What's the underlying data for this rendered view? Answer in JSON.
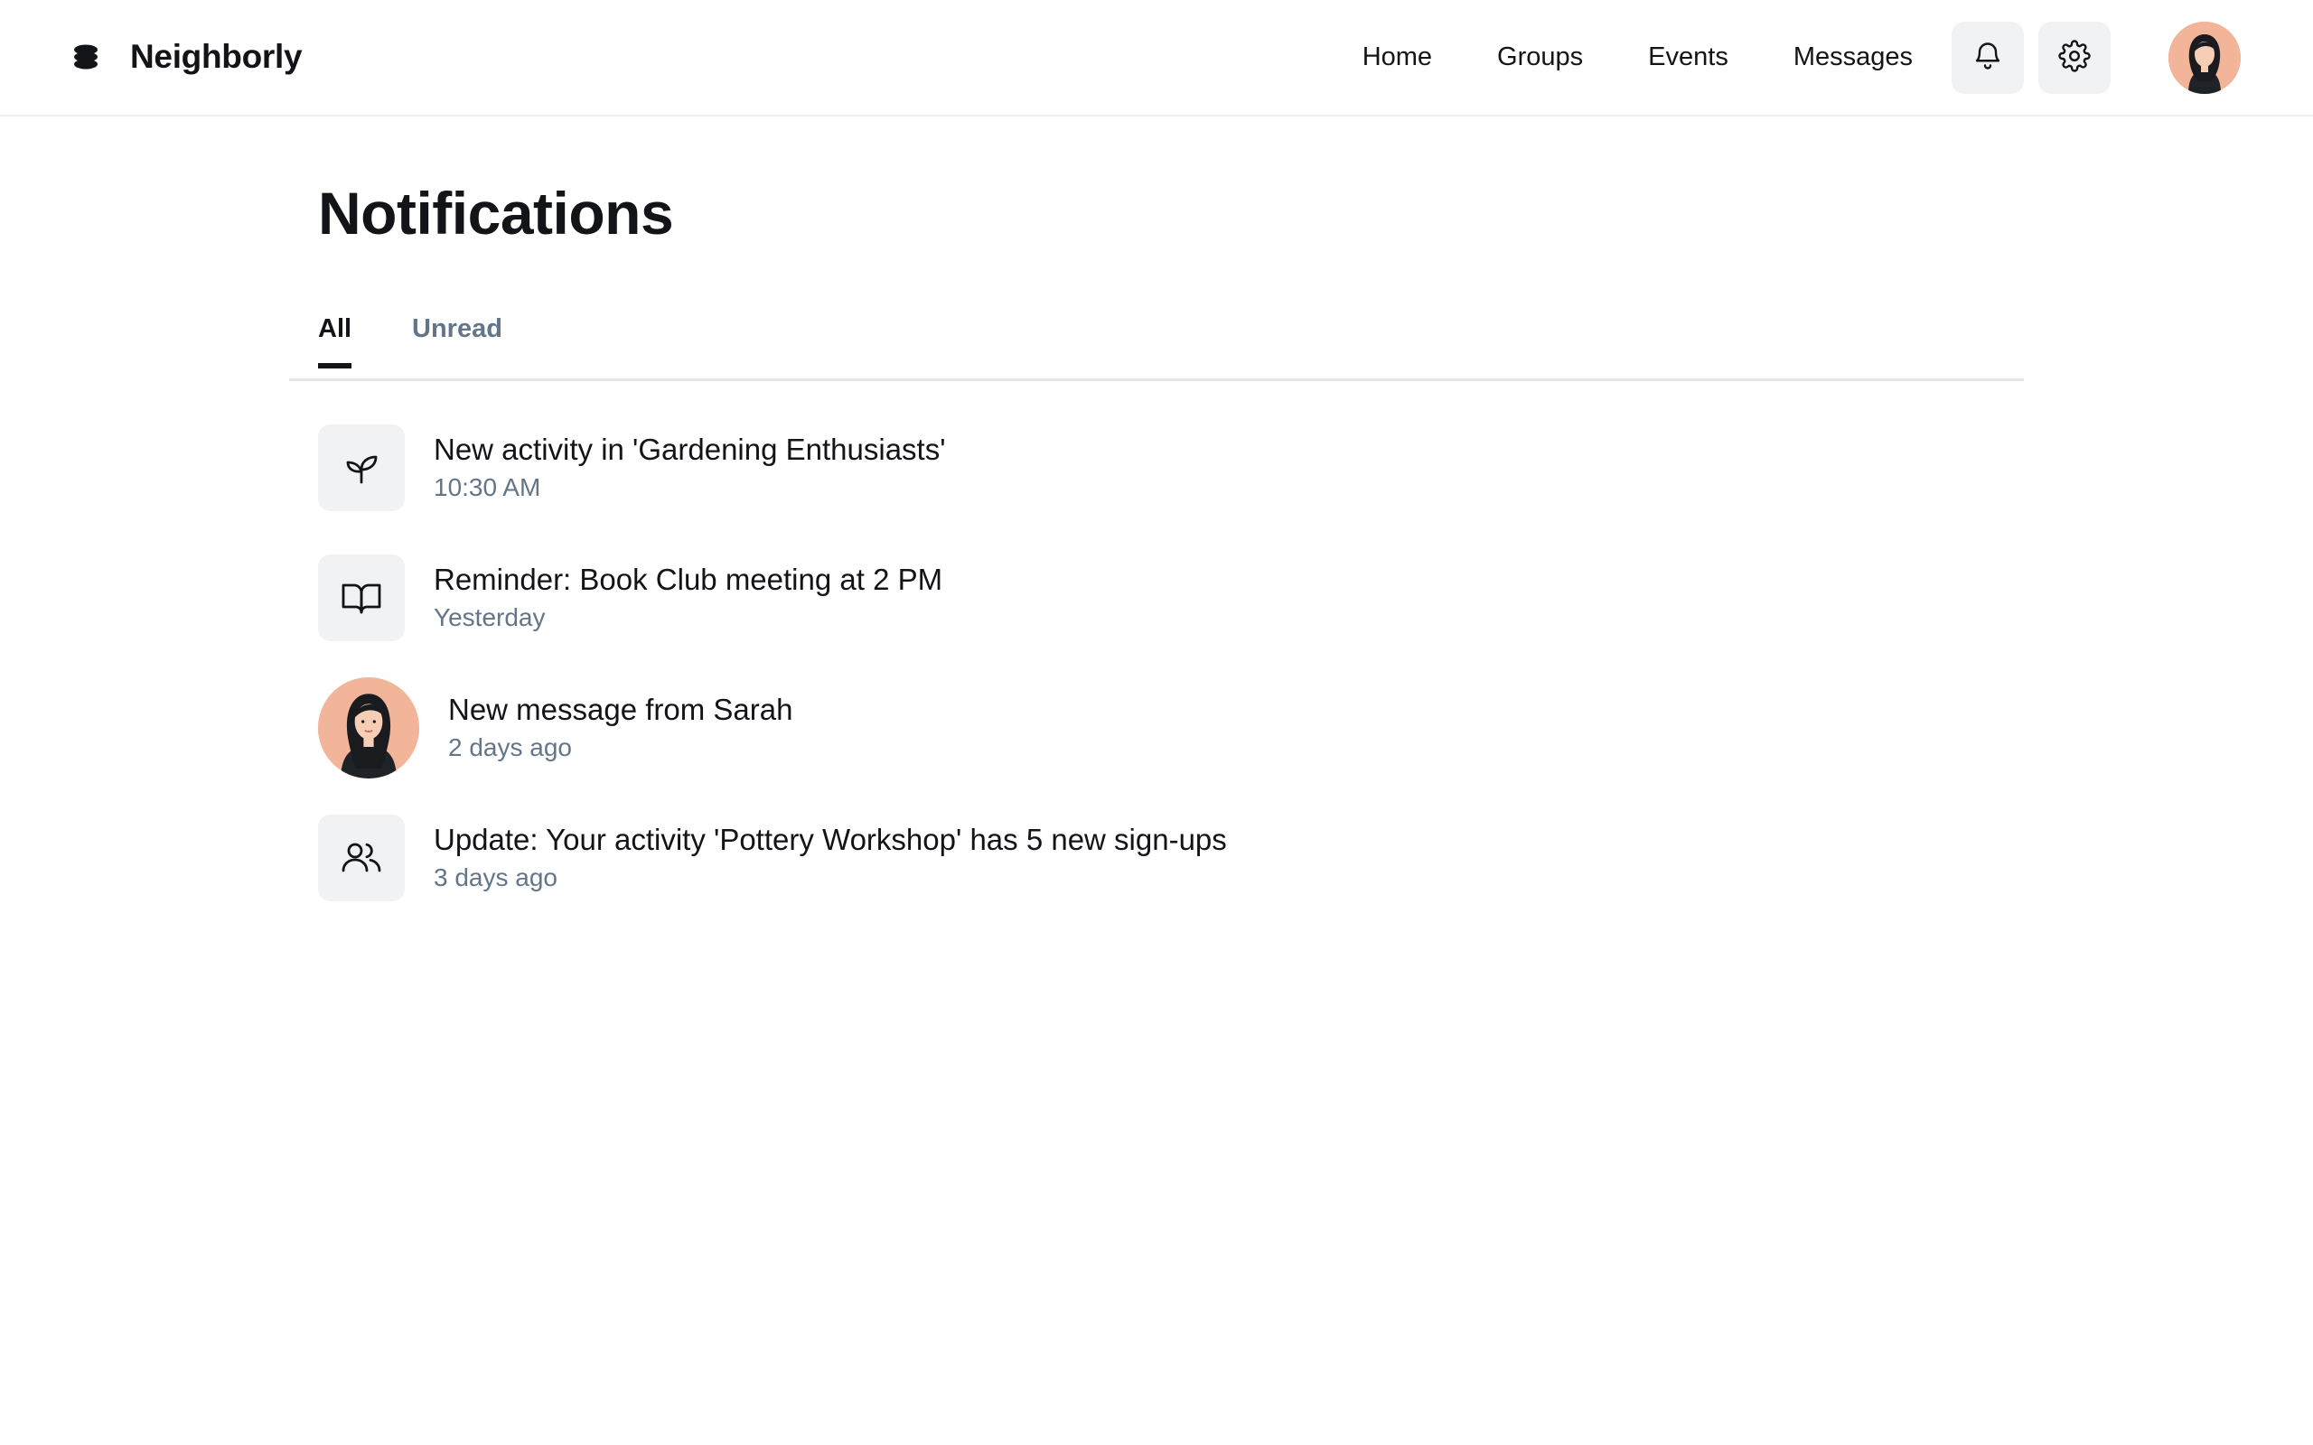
{
  "header": {
    "brand_name": "Neighborly",
    "nav": [
      "Home",
      "Groups",
      "Events",
      "Messages"
    ],
    "notifications_icon": "bell-icon",
    "settings_icon": "gear-icon",
    "avatar": "user-avatar"
  },
  "main": {
    "title": "Notifications",
    "tabs": [
      {
        "label": "All",
        "active": true
      },
      {
        "label": "Unread",
        "active": false
      }
    ],
    "notifications": [
      {
        "icon": "plant-icon",
        "title": "New activity in 'Gardening Enthusiasts'",
        "time": "10:30 AM"
      },
      {
        "icon": "book-icon",
        "title": "Reminder: Book Club meeting at 2 PM",
        "time": "Yesterday"
      },
      {
        "icon": "sarah-avatar",
        "title": "New message from Sarah",
        "time": "2 days ago"
      },
      {
        "icon": "users-icon",
        "title": "Update: Your activity 'Pottery Workshop' has 5 new sign-ups",
        "time": "3 days ago"
      }
    ]
  },
  "colors": {
    "text_primary": "#121417",
    "text_secondary": "#637588",
    "icon_bg": "#f0f2f4",
    "divider": "#e5e8eb",
    "avatar_bg": "#f2b59a"
  }
}
